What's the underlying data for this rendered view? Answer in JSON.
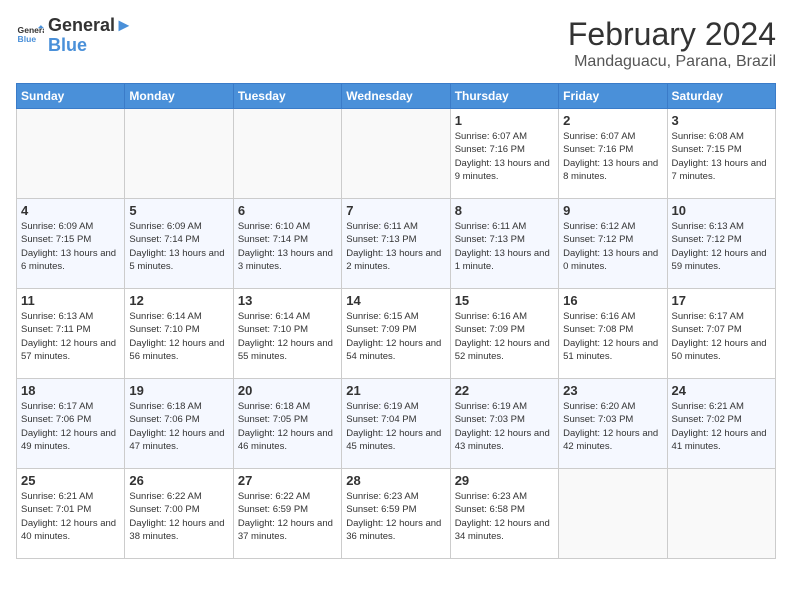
{
  "header": {
    "logo_line1": "General",
    "logo_line2": "Blue",
    "month_year": "February 2024",
    "location": "Mandaguacu, Parana, Brazil"
  },
  "days_of_week": [
    "Sunday",
    "Monday",
    "Tuesday",
    "Wednesday",
    "Thursday",
    "Friday",
    "Saturday"
  ],
  "weeks": [
    [
      {
        "day": "",
        "info": ""
      },
      {
        "day": "",
        "info": ""
      },
      {
        "day": "",
        "info": ""
      },
      {
        "day": "",
        "info": ""
      },
      {
        "day": "1",
        "info": "Sunrise: 6:07 AM\nSunset: 7:16 PM\nDaylight: 13 hours\nand 9 minutes."
      },
      {
        "day": "2",
        "info": "Sunrise: 6:07 AM\nSunset: 7:16 PM\nDaylight: 13 hours\nand 8 minutes."
      },
      {
        "day": "3",
        "info": "Sunrise: 6:08 AM\nSunset: 7:15 PM\nDaylight: 13 hours\nand 7 minutes."
      }
    ],
    [
      {
        "day": "4",
        "info": "Sunrise: 6:09 AM\nSunset: 7:15 PM\nDaylight: 13 hours\nand 6 minutes."
      },
      {
        "day": "5",
        "info": "Sunrise: 6:09 AM\nSunset: 7:14 PM\nDaylight: 13 hours\nand 5 minutes."
      },
      {
        "day": "6",
        "info": "Sunrise: 6:10 AM\nSunset: 7:14 PM\nDaylight: 13 hours\nand 3 minutes."
      },
      {
        "day": "7",
        "info": "Sunrise: 6:11 AM\nSunset: 7:13 PM\nDaylight: 13 hours\nand 2 minutes."
      },
      {
        "day": "8",
        "info": "Sunrise: 6:11 AM\nSunset: 7:13 PM\nDaylight: 13 hours\nand 1 minute."
      },
      {
        "day": "9",
        "info": "Sunrise: 6:12 AM\nSunset: 7:12 PM\nDaylight: 13 hours\nand 0 minutes."
      },
      {
        "day": "10",
        "info": "Sunrise: 6:13 AM\nSunset: 7:12 PM\nDaylight: 12 hours\nand 59 minutes."
      }
    ],
    [
      {
        "day": "11",
        "info": "Sunrise: 6:13 AM\nSunset: 7:11 PM\nDaylight: 12 hours\nand 57 minutes."
      },
      {
        "day": "12",
        "info": "Sunrise: 6:14 AM\nSunset: 7:10 PM\nDaylight: 12 hours\nand 56 minutes."
      },
      {
        "day": "13",
        "info": "Sunrise: 6:14 AM\nSunset: 7:10 PM\nDaylight: 12 hours\nand 55 minutes."
      },
      {
        "day": "14",
        "info": "Sunrise: 6:15 AM\nSunset: 7:09 PM\nDaylight: 12 hours\nand 54 minutes."
      },
      {
        "day": "15",
        "info": "Sunrise: 6:16 AM\nSunset: 7:09 PM\nDaylight: 12 hours\nand 52 minutes."
      },
      {
        "day": "16",
        "info": "Sunrise: 6:16 AM\nSunset: 7:08 PM\nDaylight: 12 hours\nand 51 minutes."
      },
      {
        "day": "17",
        "info": "Sunrise: 6:17 AM\nSunset: 7:07 PM\nDaylight: 12 hours\nand 50 minutes."
      }
    ],
    [
      {
        "day": "18",
        "info": "Sunrise: 6:17 AM\nSunset: 7:06 PM\nDaylight: 12 hours\nand 49 minutes."
      },
      {
        "day": "19",
        "info": "Sunrise: 6:18 AM\nSunset: 7:06 PM\nDaylight: 12 hours\nand 47 minutes."
      },
      {
        "day": "20",
        "info": "Sunrise: 6:18 AM\nSunset: 7:05 PM\nDaylight: 12 hours\nand 46 minutes."
      },
      {
        "day": "21",
        "info": "Sunrise: 6:19 AM\nSunset: 7:04 PM\nDaylight: 12 hours\nand 45 minutes."
      },
      {
        "day": "22",
        "info": "Sunrise: 6:19 AM\nSunset: 7:03 PM\nDaylight: 12 hours\nand 43 minutes."
      },
      {
        "day": "23",
        "info": "Sunrise: 6:20 AM\nSunset: 7:03 PM\nDaylight: 12 hours\nand 42 minutes."
      },
      {
        "day": "24",
        "info": "Sunrise: 6:21 AM\nSunset: 7:02 PM\nDaylight: 12 hours\nand 41 minutes."
      }
    ],
    [
      {
        "day": "25",
        "info": "Sunrise: 6:21 AM\nSunset: 7:01 PM\nDaylight: 12 hours\nand 40 minutes."
      },
      {
        "day": "26",
        "info": "Sunrise: 6:22 AM\nSunset: 7:00 PM\nDaylight: 12 hours\nand 38 minutes."
      },
      {
        "day": "27",
        "info": "Sunrise: 6:22 AM\nSunset: 6:59 PM\nDaylight: 12 hours\nand 37 minutes."
      },
      {
        "day": "28",
        "info": "Sunrise: 6:23 AM\nSunset: 6:59 PM\nDaylight: 12 hours\nand 36 minutes."
      },
      {
        "day": "29",
        "info": "Sunrise: 6:23 AM\nSunset: 6:58 PM\nDaylight: 12 hours\nand 34 minutes."
      },
      {
        "day": "",
        "info": ""
      },
      {
        "day": "",
        "info": ""
      }
    ]
  ]
}
